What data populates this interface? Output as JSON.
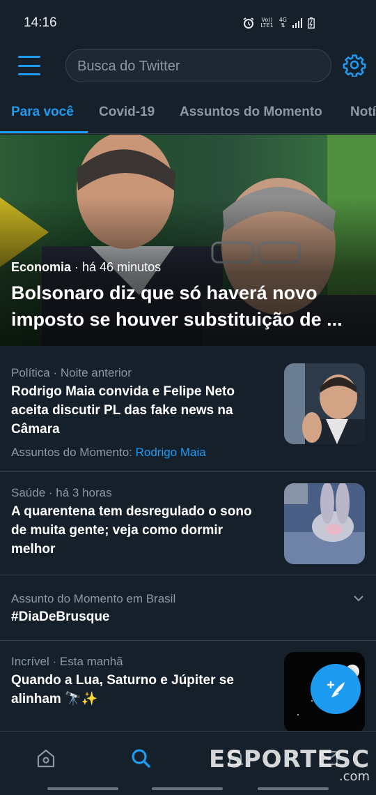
{
  "status_bar": {
    "time": "14:16",
    "volte": "Vo))",
    "lte": "LTE1",
    "network": "4G"
  },
  "header": {
    "search_placeholder": "Busca do Twitter"
  },
  "tabs": [
    {
      "label": "Para você",
      "active": true
    },
    {
      "label": "Covid-19"
    },
    {
      "label": "Assuntos do Momento"
    },
    {
      "label": "Notí"
    }
  ],
  "hero": {
    "category": "Economia",
    "time": " · há 46 minutos",
    "title": "Bolsonaro diz que só haverá novo imposto se houver substituição de ..."
  },
  "items": [
    {
      "meta": "Política · Noite anterior",
      "headline": "Rodrigo Maia convida e Felipe Neto aceita discutir PL das fake news na Câmara",
      "trend_prefix": "Assuntos do Momento: ",
      "trend_link": "Rodrigo Maia"
    },
    {
      "meta": "Saúde · há 3 horas",
      "headline": "A quarentena tem desregulado o sono de muita gente; veja como dormir melhor"
    },
    {
      "meta": "Assunto do Momento em Brasil",
      "headline": "#DiaDeBrusque"
    },
    {
      "meta": "Incrível · Esta manhã",
      "headline": "Quando a Lua, Saturno e Júpiter se alinham 🔭✨"
    }
  ],
  "watermark": {
    "main": "ESPORTESC",
    "suffix": ".com"
  },
  "colors": {
    "accent": "#1d9bf0",
    "background": "#15202b",
    "secondary_text": "#8b98a5",
    "divider": "#38444d"
  },
  "icons": {
    "menu": "hamburger-icon",
    "settings": "gear-icon",
    "compose": "feather-plus-icon",
    "home": "home-icon",
    "search": "search-icon",
    "notifications": "bell-icon",
    "messages": "envelope-icon"
  }
}
